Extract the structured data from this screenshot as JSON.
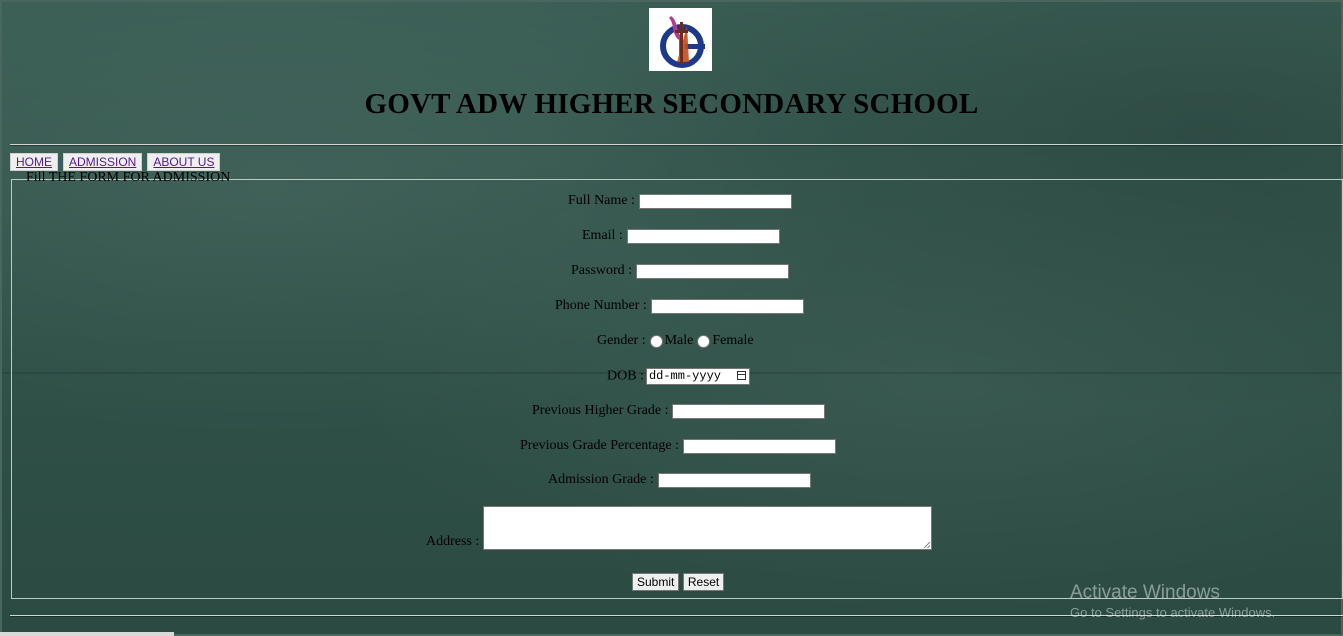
{
  "header": {
    "logo_alt": "school-logo",
    "title": "GOVT ADW HIGHER SECONDARY SCHOOL"
  },
  "nav": {
    "items": [
      {
        "label": "HOME"
      },
      {
        "label": "ADMISSION"
      },
      {
        "label": "ABOUT US"
      }
    ]
  },
  "form": {
    "legend": "Fill THE FORM FOR ADMISSION",
    "full_name_label": "Full Name :",
    "email_label": "Email :",
    "password_label": "Password :",
    "phone_label": "Phone Number :",
    "gender_label": "Gender :",
    "gender_male": "Male",
    "gender_female": "Female",
    "dob_label": "DOB :",
    "dob_placeholder": "dd-mm-yyyy",
    "prev_grade_label": "Previous Higher Grade :",
    "prev_pct_label": "Previous Grade Percentage :",
    "admission_grade_label": "Admission Grade :",
    "address_label": "Address :",
    "submit_label": "Submit",
    "reset_label": "Reset"
  },
  "watermark": {
    "line1": "Activate Windows",
    "line2": "Go to Settings to activate Windows."
  },
  "colors": {
    "board": "#2f5249",
    "link": "#551a8b"
  }
}
